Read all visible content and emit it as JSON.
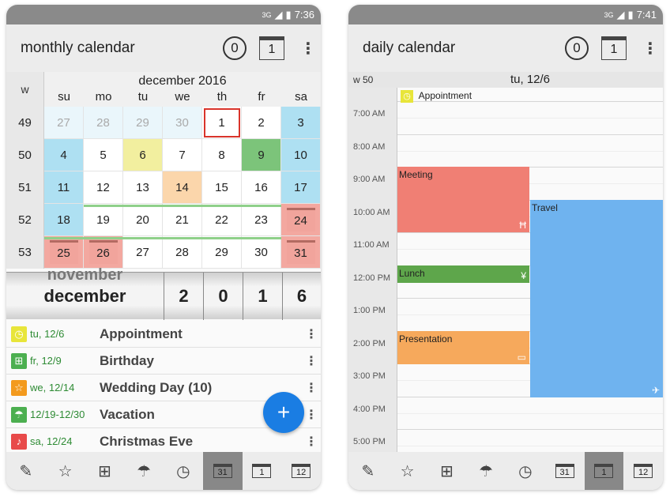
{
  "status": {
    "left_time": "7:36",
    "right_time": "7:41",
    "network": "3G"
  },
  "monthly": {
    "title": "monthly calendar",
    "badge_circle": "0",
    "badge_square": "1",
    "week_header": "w",
    "month_label": "december 2016",
    "dow": [
      "su",
      "mo",
      "tu",
      "we",
      "th",
      "fr",
      "sa"
    ],
    "weeks": [
      "49",
      "50",
      "51",
      "52",
      "53"
    ],
    "days": [
      [
        "27",
        "28",
        "29",
        "30",
        "1",
        "2",
        "3"
      ],
      [
        "4",
        "5",
        "6",
        "7",
        "8",
        "9",
        "10"
      ],
      [
        "11",
        "12",
        "13",
        "14",
        "15",
        "16",
        "17"
      ],
      [
        "18",
        "19",
        "20",
        "21",
        "22",
        "23",
        "24"
      ],
      [
        "25",
        "26",
        "27",
        "28",
        "29",
        "30",
        "31"
      ]
    ],
    "picker": {
      "month": "december",
      "prev_month": "november",
      "digits": [
        "2",
        "0",
        "1",
        "6"
      ]
    },
    "events": [
      {
        "date": "tu, 12/6",
        "name": "Appointment",
        "icon": "clock-icon",
        "color": "#e8e53a"
      },
      {
        "date": "fr, 12/9",
        "name": "Birthday",
        "icon": "gift-icon",
        "color": "#4caf50"
      },
      {
        "date": "we, 12/14",
        "name": "Wedding Day (10)",
        "icon": "star-icon",
        "color": "#f39a1e"
      },
      {
        "date": "12/19-12/30",
        "name": "Vacation",
        "icon": "umbrella-icon",
        "color": "#4caf50"
      },
      {
        "date": "sa, 12/24",
        "name": "Christmas Eve",
        "icon": "bell-icon",
        "color": "#e84a4a"
      }
    ],
    "fab": "+"
  },
  "daily": {
    "title": "daily calendar",
    "badge_circle": "0",
    "badge_square": "1",
    "week": "w 50",
    "date": "tu, 12/6",
    "hours": [
      "7:00 AM",
      "8:00 AM",
      "9:00 AM",
      "10:00 AM",
      "11:00 AM",
      "12:00 PM",
      "1:00 PM",
      "2:00 PM",
      "3:00 PM",
      "4:00 PM",
      "5:00 PM"
    ],
    "events": {
      "appointment": "Appointment",
      "meeting": "Meeting",
      "travel": "Travel",
      "lunch": "Lunch",
      "presentation": "Presentation"
    }
  },
  "nav": {
    "month_num": "31",
    "day_num": "1",
    "year_num": "12"
  },
  "colors": {
    "accent": "#1a7de3",
    "weekend": "#aee0f2",
    "holiday": "#f3a8a0",
    "meeting": "#f07f74",
    "travel": "#6fb3ef",
    "lunch": "#5ea64b",
    "presentation": "#f6a95c"
  }
}
